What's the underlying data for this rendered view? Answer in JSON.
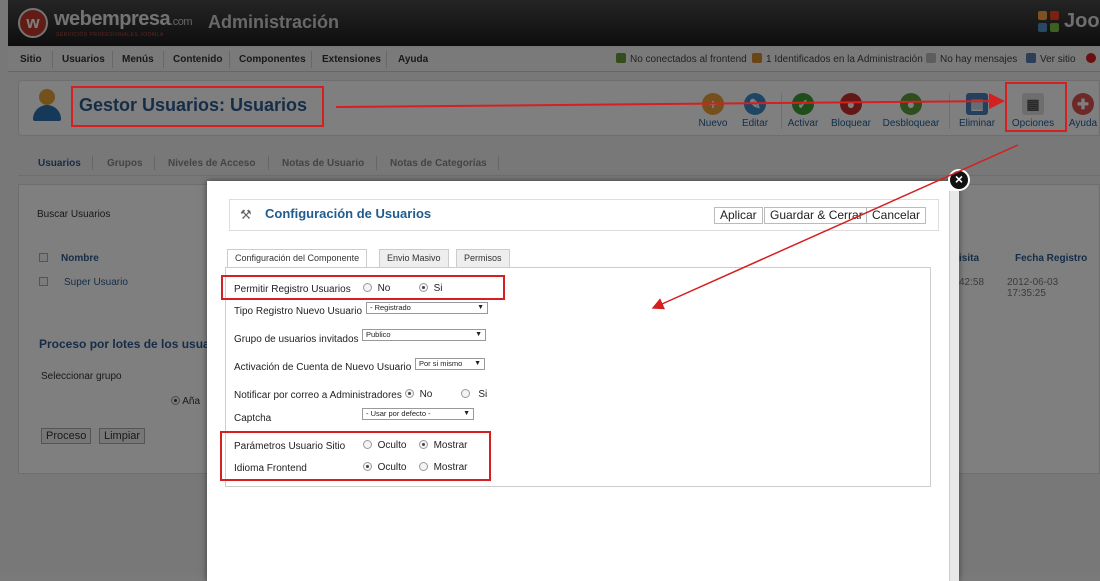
{
  "header": {
    "brand": "webempresa",
    "brand_suffix": ".com",
    "tagline": "SERVICIOS PROFESIONALES JOOMLA",
    "title": "Administración",
    "joomla": "Joo"
  },
  "menu": [
    "Sitio",
    "Usuarios",
    "Menús",
    "Contenido",
    "Componentes",
    "Extensiones",
    "Ayuda"
  ],
  "status": {
    "frontend": "No conectados al frontend",
    "admin": "1 Identificados en la Administración",
    "messages": "No hay mensajes",
    "view_site": "Ver sitio"
  },
  "page": {
    "title": "Gestor Usuarios: Usuarios"
  },
  "toolbar": {
    "nuevo": "Nuevo",
    "editar": "Editar",
    "activar": "Activar",
    "bloquear": "Bloquear",
    "desbloquear": "Desbloquear",
    "eliminar": "Eliminar",
    "opciones": "Opciones",
    "ayuda": "Ayuda"
  },
  "subnav": [
    "Usuarios",
    "Grupos",
    "Niveles de Acceso",
    "Notas de Usuario",
    "Notas de Categorías"
  ],
  "list": {
    "search_label": "Buscar Usuarios",
    "col_name": "Nombre",
    "col_visit": "isita",
    "col_registered": "Fecha Registro",
    "row_name": "Super Usuario",
    "row_visit": "42:58",
    "row_registered": "2012-06-03 17:35:25"
  },
  "batch": {
    "title": "Proceso por lotes de los usuario",
    "select_group": "Seleccionar grupo",
    "add": "Aña",
    "process": "Proceso",
    "clear": "Limpiar"
  },
  "modal": {
    "title": "Configuración de Usuarios",
    "apply": "Aplicar",
    "save_close": "Guardar & Cerrar",
    "cancel": "Cancelar",
    "tabs": [
      "Configuración del Componente",
      "Envio Masivo",
      "Permisos"
    ],
    "fields": {
      "allow_registration": "Permitir Registro Usuarios",
      "registration_type": "Tipo Registro Nuevo Usuario",
      "registration_type_value": "- Registrado",
      "guest_group": "Grupo de usuarios invitados",
      "guest_group_value": "Publico",
      "activation": "Activación de Cuenta de Nuevo Usuario",
      "activation_value": "Por si mismo",
      "notify_admins": "Notificar por correo a Administradores",
      "captcha": "Captcha",
      "captcha_value": "- Usar por defecto -",
      "site_params": "Parámetros Usuario Sitio",
      "frontend_lang": "Idioma Frontend"
    },
    "opts": {
      "no": "No",
      "si": "Si",
      "oculto": "Oculto",
      "mostrar": "Mostrar"
    }
  }
}
